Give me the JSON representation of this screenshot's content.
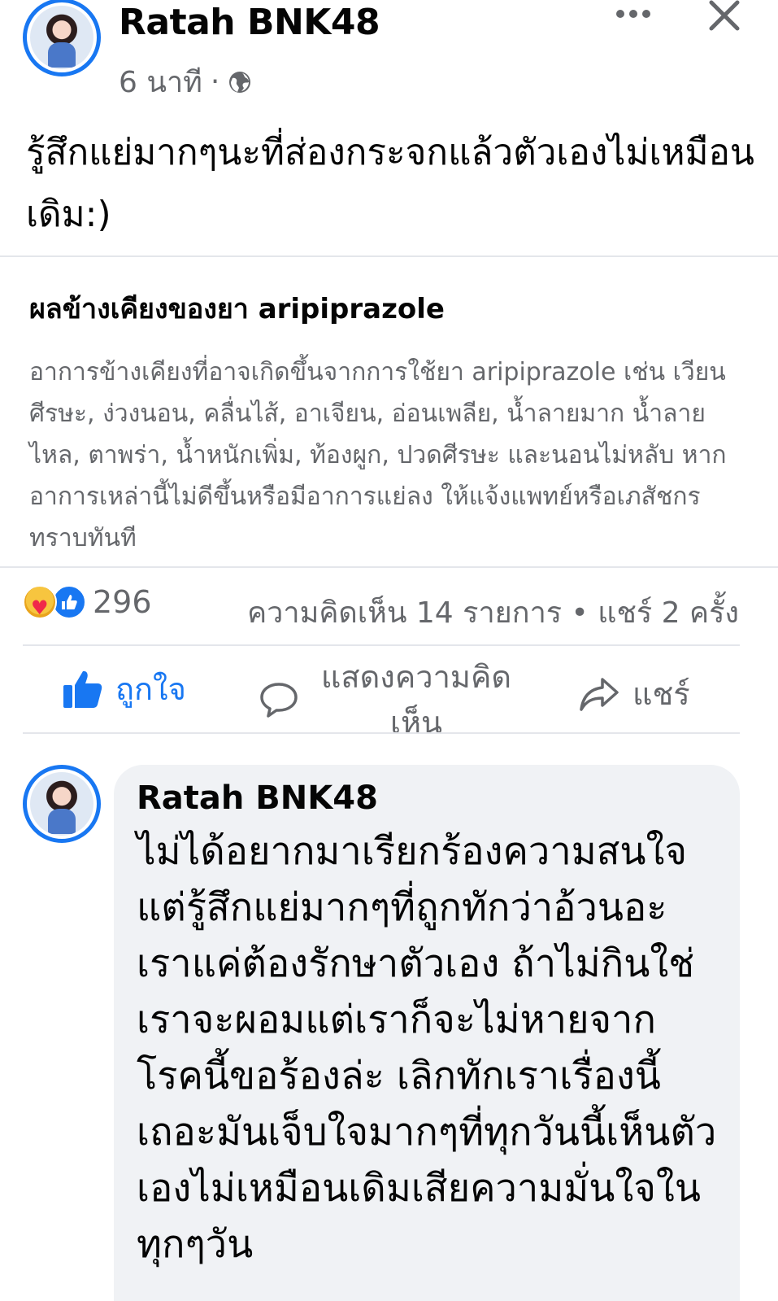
{
  "post": {
    "author": "Ratah BNK48",
    "time": "6 นาที",
    "separator": "·",
    "text": "รู้สึกแย่มากๆนะที่ส่องกระจกแล้วตัวเองไม่เหมือนเดิม:)"
  },
  "link_preview": {
    "title": "ผลข้างเคียงของยา aripiprazole",
    "description": "อาการข้างเคียงที่อาจเกิดขึ้นจากการใช้ยา aripiprazole เช่น เวียนศีรษะ, ง่วงนอน, คลื่นไส้, อาเจียน, อ่อนเพลีย, น้ำลายมาก น้ำลายไหล, ตาพร่า, น้ำหนักเพิ่ม, ท้องผูก, ปวดศีรษะ และนอนไม่หลับ หากอาการเหล่านี้ไม่ดีขึ้นหรือมีอาการแย่ลง ให้แจ้งแพทย์หรือเภสัชกรทราบทันที"
  },
  "stats": {
    "reaction_count": "296",
    "comments_shares": "ความคิดเห็น 14 รายการ • แชร์ 2 ครั้ง",
    "reaction_icons": [
      "care-icon",
      "like-icon"
    ]
  },
  "actions": {
    "like": "ถูกใจ",
    "comment": "แสดงความคิดเห็น",
    "share": "แชร์"
  },
  "comment": {
    "author": "Ratah BNK48",
    "text": "ไม่ได้อยากมาเรียกร้องความสนใจ แต่รู้สึกแย่มากๆที่ถูกทักว่าอ้วนอะ เราแค่ต้องรักษาตัวเอง ถ้าไม่กินใช่เราจะผอมแต่เราก็จะไม่หายจากโรคนี้ขอร้องล่ะ เลิกทักเราเรื่องนี้เถอะมันเจ็บใจมากๆที่ทุกวันนี้เห็นตัวเองไม่เหมือนเดิมเสียความมั่นใจในทุกๆวัน"
  },
  "colors": {
    "accent": "#1877f2",
    "secondary_text": "#65676b",
    "bubble": "#f0f2f5"
  }
}
